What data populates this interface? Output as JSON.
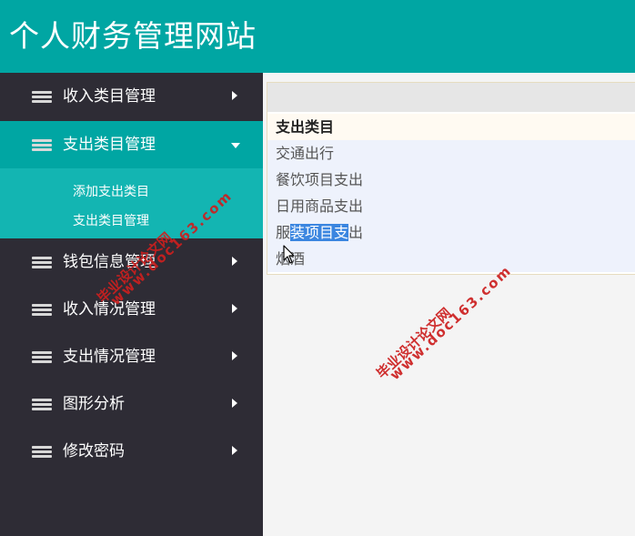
{
  "header": {
    "title": "个人财务管理网站"
  },
  "sidebar": {
    "items": [
      {
        "label": "收入类目管理",
        "icon": "stack-icon",
        "arrow": "right"
      },
      {
        "label": "支出类目管理",
        "icon": "stack-icon",
        "arrow": "down",
        "active": true,
        "children": [
          {
            "label": "添加支出类目"
          },
          {
            "label": "支出类目管理"
          }
        ]
      },
      {
        "label": "钱包信息管理",
        "icon": "stack-icon",
        "arrow": "right"
      },
      {
        "label": "收入情况管理",
        "icon": "stack-icon",
        "arrow": "right"
      },
      {
        "label": "支出情况管理",
        "icon": "stack-icon",
        "arrow": "right"
      },
      {
        "label": "图形分析",
        "icon": "stack-icon",
        "arrow": "right"
      },
      {
        "label": "修改密码",
        "icon": "stack-icon",
        "arrow": "right"
      }
    ]
  },
  "table": {
    "header": "支出类目",
    "rows": [
      "交通出行",
      "餐饮项目支出",
      "日用商品支出",
      "服装项目支出",
      "烟酒"
    ],
    "selection": {
      "row": 3,
      "before": "服",
      "selected": "装项目支",
      "after": "出"
    }
  },
  "watermark": {
    "text_cn": "毕业设计论文网",
    "text_url": "www.doc163.com"
  },
  "colors": {
    "header_bg": "#00a6a3",
    "sidebar_bg": "#2e2c35",
    "active_bg": "#00a6a3",
    "submenu_bg": "#13b5b2",
    "watermark": "#cc1f1f"
  }
}
